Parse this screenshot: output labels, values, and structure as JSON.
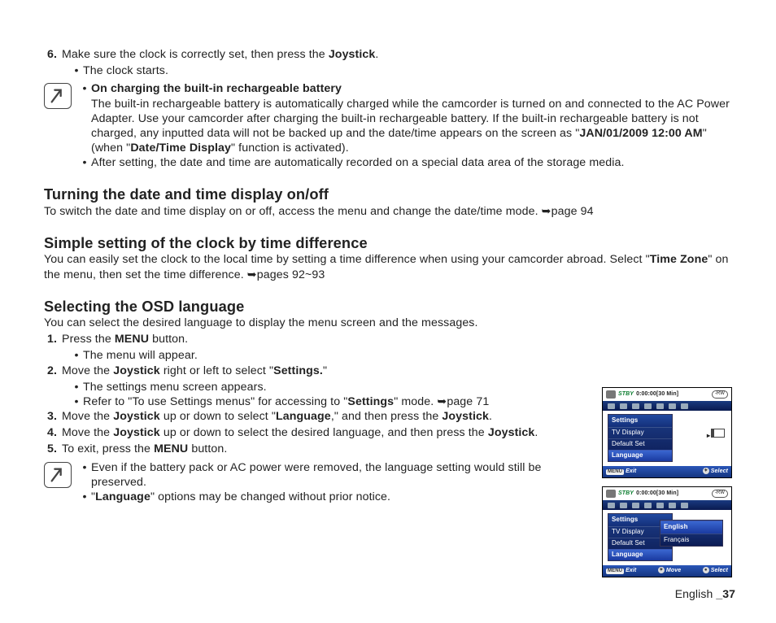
{
  "step6": {
    "num": "6.",
    "text_a": "Make sure the clock is correctly set, then press the ",
    "text_b": "Joystick",
    "text_c": ".",
    "bullet": "The clock starts."
  },
  "note1": {
    "b1_title": "On charging the built-in rechargeable battery",
    "b1_body_a": "The built-in rechargeable battery is automatically charged while the camcorder is turned on and connected to the AC Power Adapter. Use your camcorder after charging the built-in rechargeable battery. If the built-in rechargeable battery is not charged, any inputted data will not be backed up and the date/time appears on the screen as \"",
    "b1_body_b": "JAN/01/2009 12:00 AM",
    "b1_body_c": "\" (when \"",
    "b1_body_d": "Date/Time Display",
    "b1_body_e": "\" function is activated).",
    "b2": "After setting, the date and time are automatically recorded on a special data area of the storage media."
  },
  "sec1": {
    "title": "Turning the date and time display on/off",
    "body": "To switch the date and time display on or off, access the menu and change the date/time mode. ➥page 94"
  },
  "sec2": {
    "title": "Simple setting of the clock by time difference",
    "body_a": "You can easily set the clock to the local time by setting a time difference when using your camcorder abroad. Select \"",
    "body_b": "Time Zone",
    "body_c": "\" on the menu, then set the time difference. ➥pages 92~93"
  },
  "sec3": {
    "title": "Selecting the OSD language",
    "intro": "You can select the desired language to display the menu screen and the messages.",
    "s1_a": "Press the ",
    "s1_b": "MENU",
    "s1_c": " button.",
    "s1_bul": "The menu will appear.",
    "s2_a": "Move the ",
    "s2_b": "Joystick",
    "s2_c": " right or left to select \"",
    "s2_d": "Settings.",
    "s2_e": "\"",
    "s2_bul1": "The settings menu screen appears.",
    "s2_bul2_a": "Refer to \"To use Settings menus\" for accessing to \"",
    "s2_bul2_b": "Settings",
    "s2_bul2_c": "\" mode. ➥page 71",
    "s3_a": "Move the ",
    "s3_b": "Joystick",
    "s3_c": " up or down to select \"",
    "s3_d": "Language",
    "s3_e": ",\" and then press the ",
    "s3_f": "Joystick",
    "s3_g": ".",
    "s4_a": "Move the ",
    "s4_b": "Joystick",
    "s4_c": " up or down to select the desired language, and then press the ",
    "s4_d": "Joystick",
    "s4_e": ".",
    "s5_a": "To exit, press the ",
    "s5_b": "MENU",
    "s5_c": " button."
  },
  "note2": {
    "b1": "Even if the battery pack or AC power were removed, the language setting would still be preserved.",
    "b2_a": "\"",
    "b2_b": "Language",
    "b2_c": "\" options may be changed without prior notice."
  },
  "fig": {
    "stby": "STBY",
    "time": "0:00:00[30 Min]",
    "rw": "-RW",
    "menu_hdr": "Settings",
    "items": [
      "TV Display",
      "Default Set",
      "Language"
    ],
    "sub": [
      "English",
      "Français"
    ],
    "bot_menu": "MENU",
    "bot_exit": "Exit",
    "bot_move": "Move",
    "bot_select": "Select"
  },
  "footer": {
    "lang": "English ",
    "page": "_37"
  }
}
